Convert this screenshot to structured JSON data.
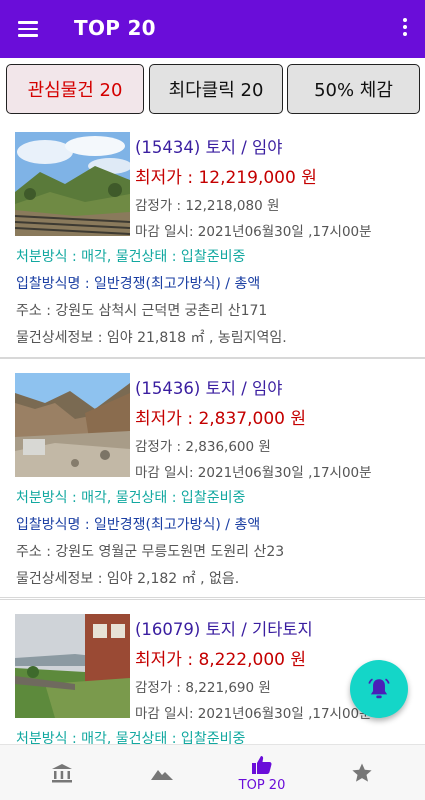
{
  "appbar": {
    "title": "TOP 20"
  },
  "tabs": [
    {
      "label": "관심물건 20",
      "active": true
    },
    {
      "label": "최다클릭 20",
      "active": false
    },
    {
      "label": "50% 체감",
      "active": false
    }
  ],
  "items": [
    {
      "title": "(15434)  토지 / 임야",
      "price": "최저가 : 12,219,000 원",
      "appraisal": "감정가 : 12,218,080 원",
      "deadline": "마감 일시: 2021년06월30일 ,17시00분",
      "method": "처분방식 : 매각,  물건상태 : 입찰준비중",
      "bid": "입찰방식명 : 일반경쟁(최고가방식) / 총액",
      "address": "주소 : 강원도 삼척시 근덕면 궁촌리 산171",
      "detail": "물건상세정보 : 임야 21,818 ㎡ , 농림지역임."
    },
    {
      "title": "(15436)  토지 / 임야",
      "price": "최저가 : 2,837,000 원",
      "appraisal": "감정가 : 2,836,600 원",
      "deadline": "마감 일시: 2021년06월30일 ,17시00분",
      "method": "처분방식 : 매각,  물건상태 : 입찰준비중",
      "bid": "입찰방식명 : 일반경쟁(최고가방식) / 총액",
      "address": "주소 : 강원도 영월군 무릉도원면 도원리 산23",
      "detail": "물건상세정보 : 임야 2,182 ㎡ , 없음."
    },
    {
      "title": "(16079)  토지 / 기타토지",
      "price": "최저가 : 8,222,000 원",
      "appraisal": "감정가 : 8,221,690 원",
      "deadline": "마감 일시: 2021년06월30일 ,17시00분",
      "method": "처분방식 : 매각,  물건상태 : 입찰준비중",
      "bid": "",
      "address": "",
      "detail": ""
    }
  ],
  "fab": {
    "icon": "bell-alert-icon"
  },
  "bottom_nav": [
    {
      "icon": "bank-icon",
      "label": ""
    },
    {
      "icon": "mountain-icon",
      "label": ""
    },
    {
      "icon": "thumbs-up-icon",
      "label": "TOP 20"
    },
    {
      "icon": "star-icon",
      "label": ""
    }
  ],
  "colors": {
    "primary": "#6a0dd9",
    "price": "#c40000",
    "title": "#3a1ea0",
    "method": "#12a8a0",
    "bid": "#1b3fa3",
    "fab": "#14d6c8"
  }
}
